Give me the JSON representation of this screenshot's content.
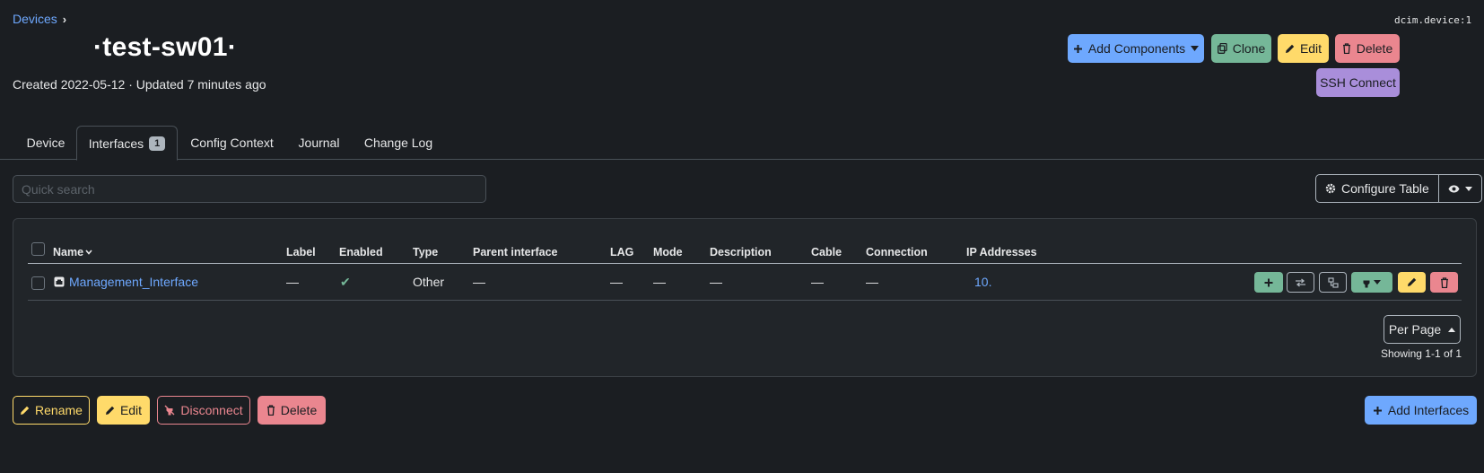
{
  "breadcrumb": {
    "devices": "Devices",
    "sep": "›"
  },
  "object_id": "dcim.device:1",
  "title": "·test-sw01·",
  "meta": "Created 2022-05-12 · Updated 7 minutes ago",
  "header_buttons": {
    "add_components": "Add Components",
    "clone": "Clone",
    "edit": "Edit",
    "delete": "Delete",
    "ssh": "SSH Connect"
  },
  "tabs": [
    {
      "label": "Device"
    },
    {
      "label": "Interfaces",
      "badge": "1"
    },
    {
      "label": "Config Context"
    },
    {
      "label": "Journal"
    },
    {
      "label": "Change Log"
    }
  ],
  "search": {
    "placeholder": "Quick search"
  },
  "configure_table": "Configure Table",
  "table": {
    "columns": [
      "Name",
      "Label",
      "Enabled",
      "Type",
      "Parent interface",
      "LAG",
      "Mode",
      "Description",
      "Cable",
      "Connection",
      "IP Addresses"
    ],
    "rows": [
      {
        "name": "Management_Interface",
        "label": "—",
        "enabled": "✔",
        "type": "Other",
        "parent": "—",
        "lag": "—",
        "mode": "—",
        "description": "—",
        "cable": "—",
        "connection": "—",
        "ip": "10."
      }
    ]
  },
  "per_page": "Per Page",
  "showing": "Showing 1-1 of 1",
  "bottom_buttons": {
    "rename": "Rename",
    "edit": "Edit",
    "disconnect": "Disconnect",
    "delete": "Delete",
    "add_interfaces": "Add Interfaces"
  },
  "colors": {
    "background": "#1b1e22",
    "primary": "#6ea8fe",
    "success": "#75b798",
    "warning": "#ffda6a",
    "danger": "#ea868f",
    "purple": "#a98eda"
  }
}
